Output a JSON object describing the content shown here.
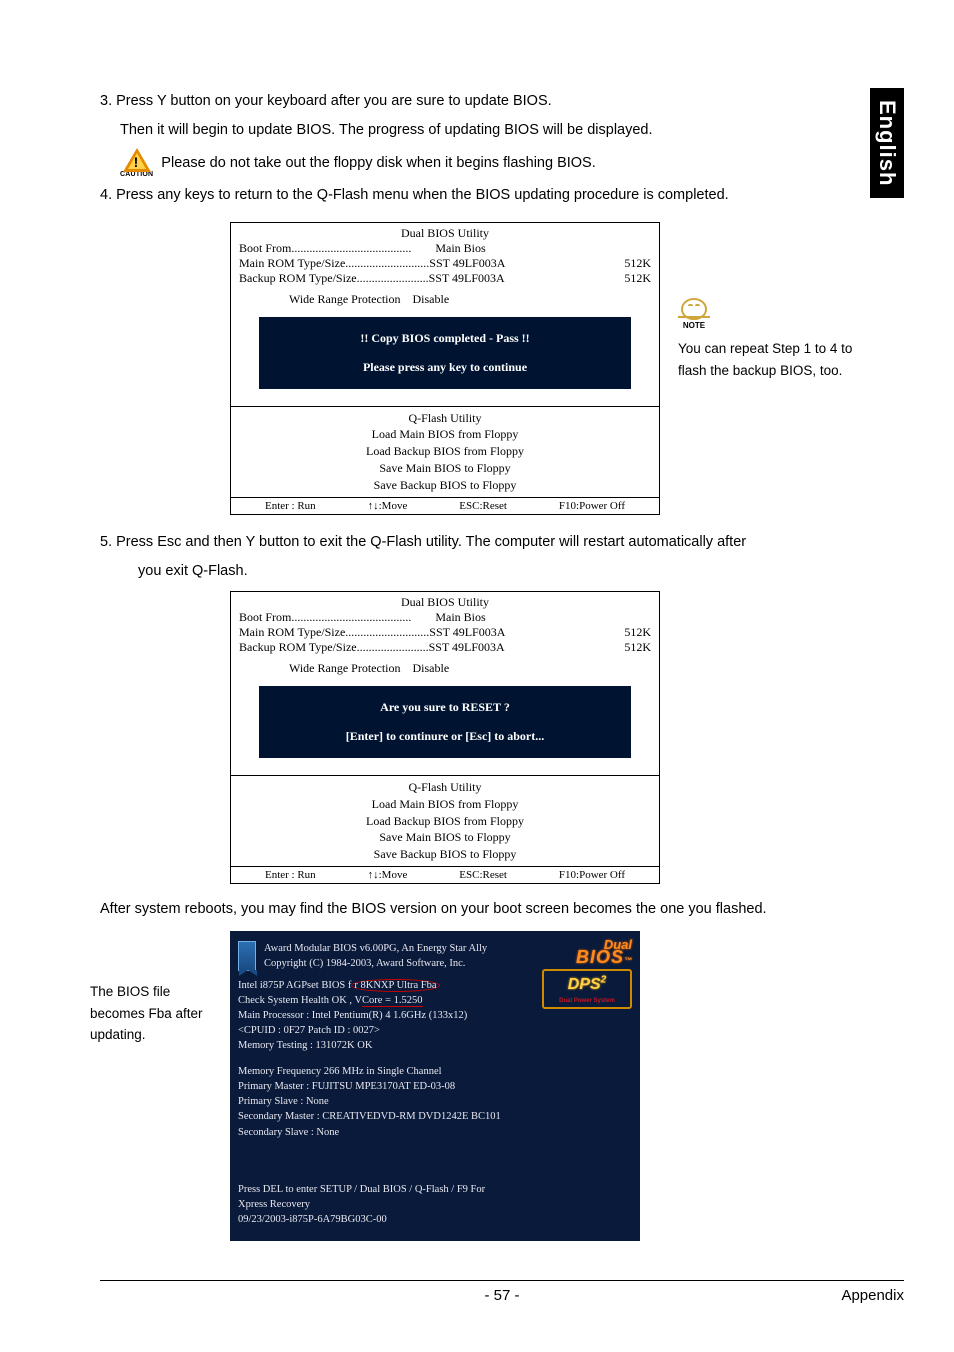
{
  "side_tab": "English",
  "steps": {
    "s3a": "3.  Press Y button on your keyboard after you are sure to update BIOS.",
    "s3b": "Then it will begin to update BIOS. The progress of updating BIOS will be displayed.",
    "caution": "Please do not take out the floppy disk when it begins flashing BIOS.",
    "s4": "4.  Press any keys to return to the Q-Flash menu when the BIOS updating procedure is completed.",
    "s5": "5.    Press Esc and then Y button to exit the Q-Flash utility. The computer will restart automatically after",
    "s5b": "you exit Q-Flash.",
    "after": "After system reboots, you may find the BIOS version on your boot screen becomes the one you flashed."
  },
  "caution_label": "CAUTION",
  "note_label": "NOTE",
  "note_text": "You can repeat Step 1 to 4 to flash the backup BIOS, too.",
  "utility1": {
    "title": "Dual BIOS Utility",
    "boot_from_label": "Boot From",
    "boot_from_value": "Main Bios",
    "main_rom_label": "Main ROM Type/Size",
    "main_rom_value": "SST 49LF003A",
    "main_rom_size": "512K",
    "backup_rom_label": "Backup ROM Type/Size",
    "backup_rom_value": "SST 49LF003A",
    "backup_rom_size": "512K",
    "wide_label": "Wide Range Protection",
    "wide_value": "Disable",
    "msg1": "!! Copy BIOS completed - Pass !!",
    "msg2": "Please press any key to continue",
    "qtitle": "Q-Flash Utility",
    "opts": [
      "Load Main BIOS from Floppy",
      "Load Backup BIOS from Floppy",
      "Save Main BIOS to Floppy",
      "Save Backup BIOS to Floppy"
    ],
    "nav": [
      "Enter : Run",
      "↑↓:Move",
      "ESC:Reset",
      "F10:Power Off"
    ]
  },
  "utility2": {
    "title": "Dual BIOS Utility",
    "wide_label": "Wide Range Protection",
    "wide_value": "Disable",
    "msg1": "Are you sure to RESET ?",
    "msg2": "[Enter] to continure or [Esc] to abort...",
    "qtitle": "Q-Flash Utility"
  },
  "callout": "The BIOS file becomes Fba after updating.",
  "bios": {
    "h1": "Award Modular BIOS v6.00PG, An Energy Star Ally",
    "h2": "Copyright (C) 1984-2003, Award Software, Inc.",
    "l1a": "Intel i875P AGPset BIOS f",
    "l1b": "r 8KNXP Ultra Fba",
    "l2a": "Check System Health OK , V",
    "l2b": "Core = 1.5250",
    "l3": "Main Processor : Intel Pentium(R) 4  1.6GHz (133x12)",
    "l4": "<CPUID : 0F27 Patch ID  : 0027>",
    "l5": "Memory Testing  : 131072K OK",
    "l6": "Memory Frequency 266 MHz in Single Channel",
    "l7": "Primary Master : FUJITSU MPE3170AT ED-03-08",
    "l8": "Primary Slave : None",
    "l9": "Secondary Master : CREATIVEDVD-RM DVD1242E BC101",
    "l10": "Secondary Slave : None",
    "f1": "Press DEL to enter SETUP / Dual BIOS / Q-Flash / F9 For",
    "f2": "Xpress Recovery",
    "f3": "09/23/2003-i875P-6A79BG03C-00",
    "logo1a": "Dual",
    "logo1b": "BIOS",
    "logo2a": "DPS",
    "logo2sup": "2",
    "logo2b": "Dual Power System"
  },
  "footer": {
    "page": "- 57 -",
    "section": "Appendix"
  }
}
